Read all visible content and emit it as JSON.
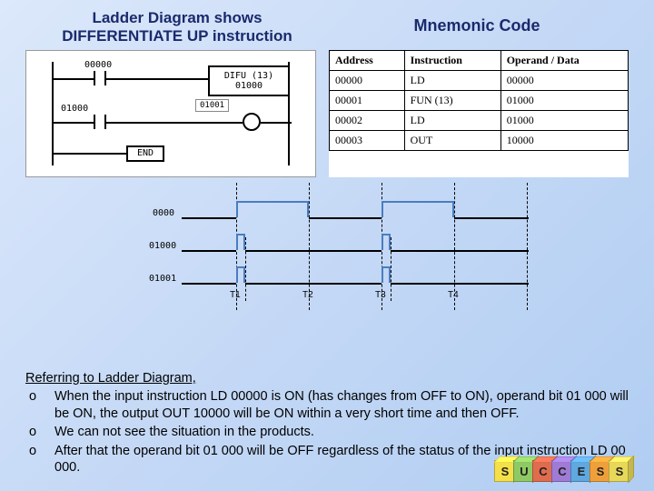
{
  "titles": {
    "left_l1": "Ladder Diagram shows",
    "left_l2": "DIFFERENTIATE UP instruction",
    "right": "Mnemonic Code"
  },
  "ladder": {
    "contact1": "00000",
    "contact2": "01000",
    "difu_box_l1": "DIFU (13)",
    "difu_box_l2": "01000",
    "coil_label": "01001",
    "end": "END"
  },
  "mnemonic": {
    "headers": {
      "addr": "Address",
      "instr": "Instruction",
      "op": "Operand / Data"
    },
    "rows": [
      {
        "addr": "00000",
        "instr": "LD",
        "op": "00000"
      },
      {
        "addr": "00001",
        "instr": "FUN (13)",
        "op": "01000"
      },
      {
        "addr": "00002",
        "instr": "LD",
        "op": "01000"
      },
      {
        "addr": "00003",
        "instr": "OUT",
        "op": "10000"
      }
    ]
  },
  "timing": {
    "signals": {
      "a": "0000",
      "b": "01000",
      "c": "01001"
    },
    "ticks": {
      "t1": "T1",
      "t2": "T2",
      "t3": "T3",
      "t4": "T4"
    }
  },
  "explain": {
    "hd": "Referring to Ladder Diagram,",
    "b1": "When the input instruction LD 00000 is ON (has changes from OFF to ON), operand bit 01 000 will be ON, the output OUT 10000 will be ON within a very short time and then OFF.",
    "b2": "We can not see the situation in the products.",
    "b3": "After that the operand bit 01 000 will be OFF regardless of the status of the input instruction LD 00 000.",
    "bullet": "o"
  },
  "blocks": [
    "S",
    "U",
    "C",
    "C",
    "E",
    "S",
    "S"
  ],
  "block_colors": [
    "#f5e04a",
    "#8fc963",
    "#e06c4e",
    "#9f7bd6",
    "#5fa8e0",
    "#f0a03a",
    "#e8d85a"
  ]
}
